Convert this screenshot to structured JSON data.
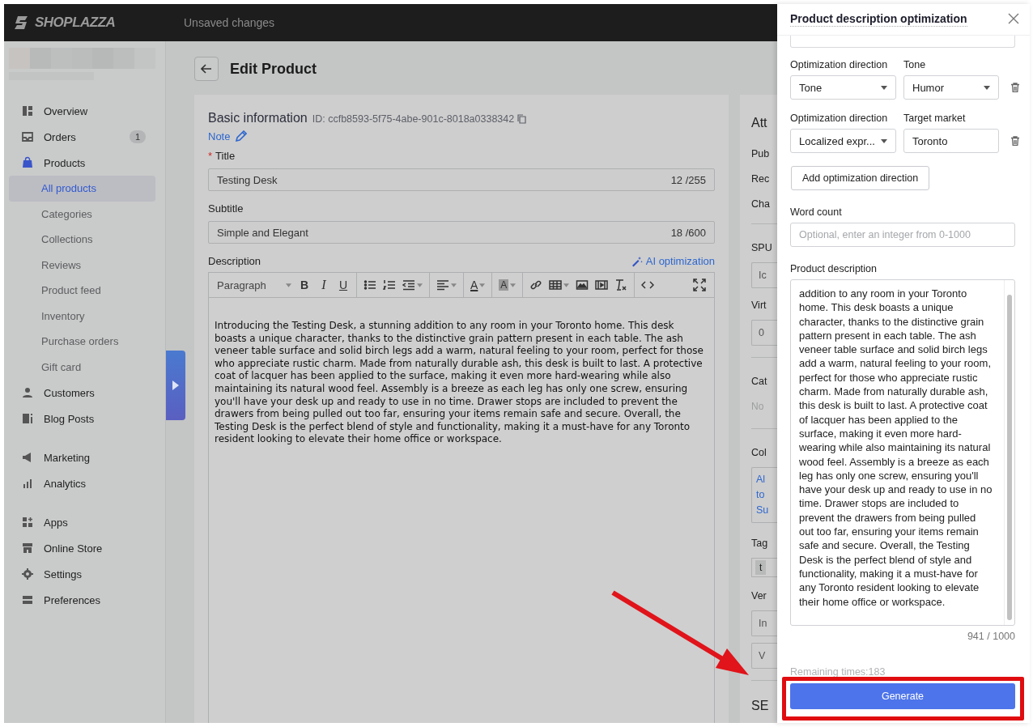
{
  "topbar": {
    "logo": "SHOPLAZZA",
    "status": "Unsaved changes"
  },
  "sidebar": {
    "groups": [
      [
        {
          "label": "Overview",
          "selected": false
        },
        {
          "label": "Orders",
          "badge": "1",
          "selected": false
        },
        {
          "label": "Products",
          "selected": false,
          "children": [
            {
              "label": "All products",
              "selected": true
            },
            {
              "label": "Categories",
              "selected": false
            },
            {
              "label": "Collections",
              "selected": false
            },
            {
              "label": "Reviews",
              "selected": false
            },
            {
              "label": "Product feed",
              "selected": false
            },
            {
              "label": "Inventory",
              "selected": false
            },
            {
              "label": "Purchase orders",
              "selected": false
            },
            {
              "label": "Gift card",
              "selected": false
            }
          ]
        },
        {
          "label": "Customers",
          "selected": false
        },
        {
          "label": "Blog Posts",
          "selected": false
        }
      ],
      [
        {
          "label": "Marketing",
          "selected": false
        },
        {
          "label": "Analytics",
          "selected": false
        }
      ],
      [
        {
          "label": "Apps",
          "selected": false
        },
        {
          "label": "Online Store",
          "selected": false
        },
        {
          "label": "Settings",
          "selected": false
        },
        {
          "label": "Preferences",
          "selected": false
        }
      ]
    ]
  },
  "page": {
    "title": "Edit Product"
  },
  "basic_info": {
    "heading": "Basic information",
    "id": "ID: ccfb8593-5f75-4abe-901c-8018a0338342",
    "note": "Note",
    "fields": [
      {
        "label": "Title",
        "required_mark": "*",
        "value": "Testing Desk",
        "count": "12 /255"
      },
      {
        "label": "Subtitle",
        "value": "Simple and Elegant",
        "count": "18 /600"
      }
    ],
    "description": {
      "label": "Description",
      "ai_link": "AI optimization",
      "toolbar": [
        {
          "kind": "select",
          "label": "Paragraph"
        },
        {
          "kind": "bold",
          "label": "B"
        },
        {
          "kind": "italic",
          "label": "I"
        },
        {
          "kind": "underline",
          "label": "U"
        },
        {
          "kind": "sep"
        },
        {
          "kind": "bullets"
        },
        {
          "kind": "numbers"
        },
        {
          "kind": "indent"
        },
        {
          "kind": "sep"
        },
        {
          "kind": "align"
        },
        {
          "kind": "sep"
        },
        {
          "kind": "font-color",
          "label": "A"
        },
        {
          "kind": "sep"
        },
        {
          "kind": "bg-color",
          "label": "A"
        },
        {
          "kind": "sep"
        },
        {
          "kind": "link"
        },
        {
          "kind": "table"
        },
        {
          "kind": "image"
        },
        {
          "kind": "video"
        },
        {
          "kind": "clear"
        },
        {
          "kind": "sep"
        },
        {
          "kind": "code"
        },
        {
          "kind": "fullscreen"
        }
      ],
      "text": "Introducing the Testing Desk, a stunning addition to any room in your Toronto home. This desk boasts a unique character, thanks to the distinctive grain pattern present in each table. The ash veneer table surface and solid birch legs add a warm, natural feeling to your room, perfect for those who appreciate rustic charm. Made from naturally durable ash, this desk is built to last. A protective coat of lacquer has been applied to the surface, making it even more hard-wearing while also maintaining its natural wood feel. Assembly is a breeze as each leg has only one screw, ensuring you'll have your desk up and ready to use in no time. Drawer stops are included to prevent the drawers from being pulled out too far, ensuring your items remain safe and secure. Overall, the Testing Desk is the perfect blend of style and functionality, making it a must-have for any Toronto resident looking to elevate their home office or workspace."
    }
  },
  "side_panel": [
    {
      "kind": "heading",
      "text": "Att"
    },
    {
      "kind": "label",
      "text": "Pub"
    },
    {
      "kind": "label",
      "text": "Rec"
    },
    {
      "kind": "label",
      "text": "Cha"
    },
    {
      "kind": "divider"
    },
    {
      "kind": "label",
      "text": "SPU"
    },
    {
      "kind": "input",
      "text": "Ic"
    },
    {
      "kind": "label",
      "text": "Virt"
    },
    {
      "kind": "input",
      "text": "0"
    },
    {
      "kind": "divider"
    },
    {
      "kind": "label",
      "text": "Cat"
    },
    {
      "kind": "muted",
      "text": "No"
    },
    {
      "kind": "divider"
    },
    {
      "kind": "label",
      "text": "Col"
    },
    {
      "kind": "links",
      "items": [
        "Al",
        "to",
        "Su"
      ]
    },
    {
      "kind": "label",
      "text": "Tag"
    },
    {
      "kind": "tag",
      "text": "t"
    },
    {
      "kind": "label",
      "text": "Ver"
    },
    {
      "kind": "input",
      "text": "In"
    },
    {
      "kind": "input",
      "text": "V"
    },
    {
      "kind": "divider"
    },
    {
      "kind": "heading",
      "text": "SE"
    }
  ],
  "drawer": {
    "title": "Product description optimization",
    "directions": [
      {
        "kind": "select",
        "label": "Optimization direction",
        "value": "Tone",
        "second_label": "Tone",
        "second_value": "Humor"
      },
      {
        "kind": "input",
        "label": "Optimization direction",
        "value": "Localized expr...",
        "second_label": "Target market",
        "second_value": "Toronto"
      }
    ],
    "add_button": "Add optimization direction",
    "word_count": {
      "label": "Word count",
      "placeholder": "Optional, enter an integer from 0-1000"
    },
    "product_description": {
      "label": "Product description",
      "text": "addition to any room in your Toronto home. This desk boasts a unique character, thanks to the distinctive grain pattern present in each table. The ash veneer table surface and solid birch legs add a warm, natural feeling to your room, perfect for those who appreciate rustic charm. Made from naturally durable ash, this desk is built to last. A protective coat of lacquer has been applied to the surface, making it even more hard-wearing while also maintaining its natural wood feel. Assembly is a breeze as each leg has only one screw, ensuring you'll have your desk up and ready to use in no time. Drawer stops are included to prevent the drawers from being pulled out too far, ensuring your items remain safe and secure. Overall, the Testing Desk is the perfect blend of style and functionality, making it a must-have for any Toronto resident looking to elevate their home office or workspace.",
      "count": "941 / 1000"
    },
    "remaining": "Remaining times:183",
    "generate": "Generate"
  }
}
